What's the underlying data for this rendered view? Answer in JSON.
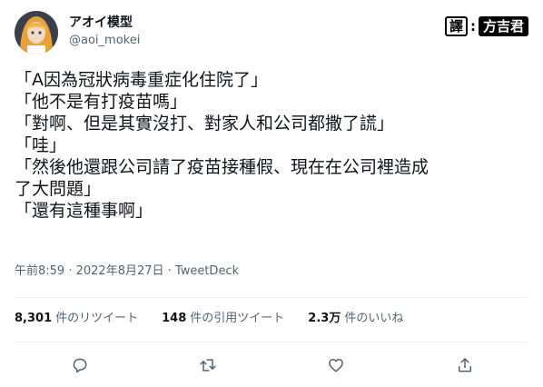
{
  "author": {
    "display_name": "アオイ模型",
    "handle": "@aoi_mokei"
  },
  "badge": {
    "left": "譯",
    "colon": ":",
    "right": "方吉君"
  },
  "tweet": {
    "lines": [
      "「A因為冠狀病毒重症化住院了」",
      "「他不是有打疫苗嗎」",
      "「對啊、但是其實沒打、對家人和公司都撒了謊」",
      "「哇」",
      "「然後他還跟公司請了疫苗接種假、現在在公司裡造成",
      "了大問題」",
      "「還有這種事啊」"
    ]
  },
  "meta": {
    "time": "午前8:59",
    "sep1": " · ",
    "date": "2022年8月27日",
    "sep2": " · ",
    "source": "TweetDeck"
  },
  "stats": {
    "retweets": {
      "count": "8,301",
      "label": "件のリツイート"
    },
    "quotes": {
      "count": "148",
      "label": "件の引用ツイート"
    },
    "likes": {
      "count": "2.3万",
      "label": "件のいいね"
    }
  },
  "actions": {
    "reply_icon": "reply-icon",
    "retweet_icon": "retweet-icon",
    "like_icon": "heart-icon",
    "share_icon": "share-icon"
  },
  "colors": {
    "text": "#0f1419",
    "secondary": "#536471",
    "divider": "#eff3f4"
  }
}
